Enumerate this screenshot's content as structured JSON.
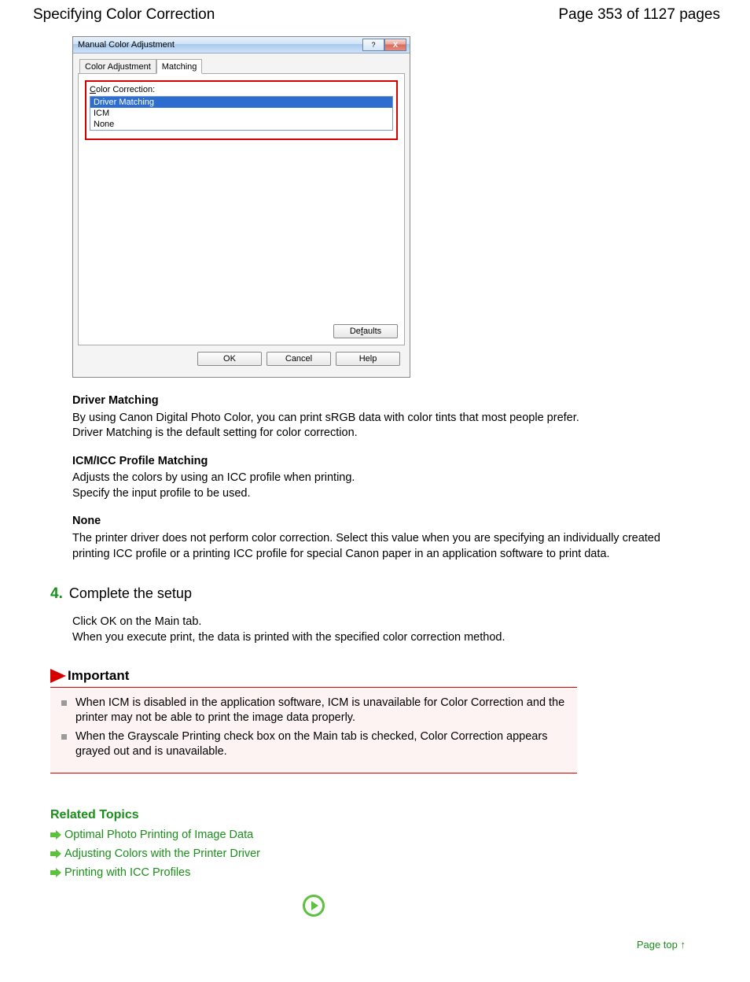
{
  "header": {
    "title": "Specifying Color Correction",
    "page_info": "Page 353 of 1127 pages"
  },
  "dialog": {
    "title": "Manual Color Adjustment",
    "help_btn": "?",
    "close_btn": "X",
    "tabs": {
      "adjust": "Color Adjustment",
      "matching": "Matching"
    },
    "cc_label_pre": "C",
    "cc_label_rest": "olor Correction:",
    "options": {
      "driver": "Driver Matching",
      "icm": "ICM",
      "none": "None"
    },
    "defaults_pre": "De",
    "defaults_u": "f",
    "defaults_post": "aults",
    "ok": "OK",
    "cancel": "Cancel",
    "help": "Help"
  },
  "driver_matching": {
    "title": "Driver Matching",
    "body1": "By using Canon Digital Photo Color, you can print sRGB data with color tints that most people prefer.",
    "body2": "Driver Matching is the default setting for color correction."
  },
  "icm": {
    "title": "ICM/ICC Profile Matching",
    "body1": "Adjusts the colors by using an ICC profile when printing.",
    "body2": "Specify the input profile to be used."
  },
  "none": {
    "title": "None",
    "body": "The printer driver does not perform color correction. Select this value when you are specifying an individually created printing ICC profile or a printing ICC profile for special Canon paper in an application software to print data."
  },
  "step4": {
    "num": "4.",
    "title": "Complete the setup",
    "line1": "Click OK on the Main tab.",
    "line2": "When you execute print, the data is printed with the specified color correction method."
  },
  "important": {
    "title": "Important",
    "item1": "When ICM is disabled in the application software, ICM is unavailable for Color Correction and the printer may not be able to print the image data properly.",
    "item2": "When the Grayscale Printing check box on the Main tab is checked, Color Correction appears grayed out and is unavailable."
  },
  "related": {
    "title": "Related Topics",
    "link1": "Optimal Photo Printing of Image Data",
    "link2": "Adjusting Colors with the Printer Driver",
    "link3": "Printing with ICC Profiles"
  },
  "page_top": "Page top",
  "page_top_arrow": "↑"
}
